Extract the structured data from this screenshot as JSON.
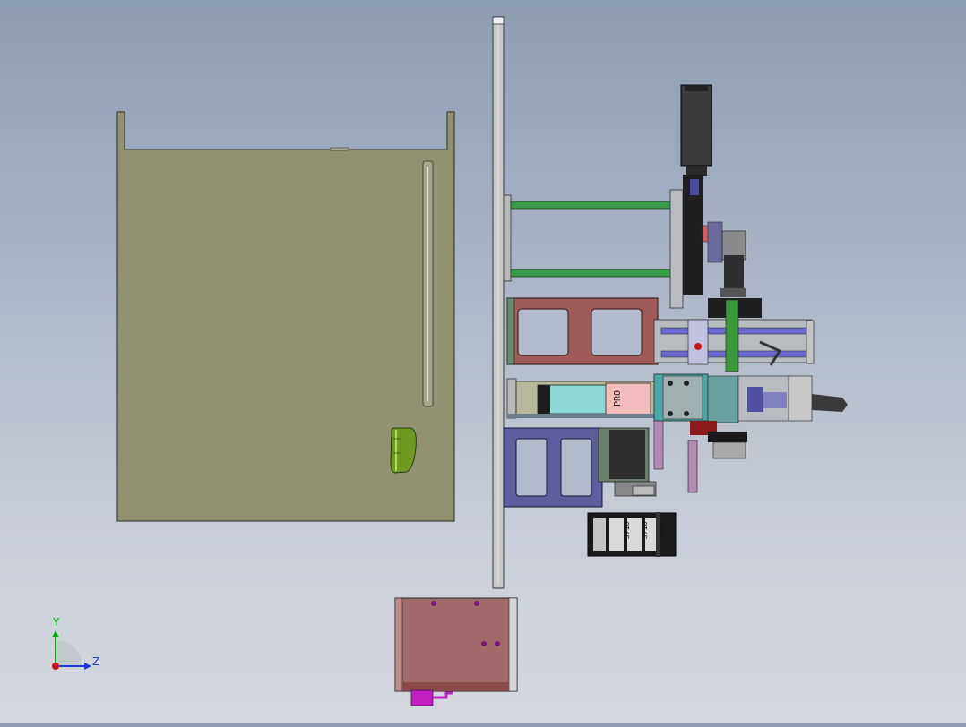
{
  "view": {
    "type": "cad-assembly-side-view",
    "background_top": "#8e9db3",
    "background_bottom": "#d4d8df"
  },
  "parts": {
    "tray_color": "#929270",
    "plate_color": "#c8c8c8",
    "frame_red": "#a05a5a",
    "frame_blue": "#5e5e9c",
    "rod_green": "#3c9a4c",
    "rod_blue": "#6a6ad0",
    "motor_color": "#2e2e2e",
    "cylinder_color": "#8ed8d6",
    "base_block": "#a06a6a",
    "connector": "#c020c0"
  },
  "labels": {
    "cylinder_brand": "PRO",
    "cable_chain_marks": [
      "3718",
      "3718",
      "3718"
    ]
  },
  "triad": {
    "y_axis": "Y",
    "z_axis": "Z",
    "y_color": "#00b000",
    "z_color": "#1a3ad0",
    "x_color": "#d01010"
  }
}
